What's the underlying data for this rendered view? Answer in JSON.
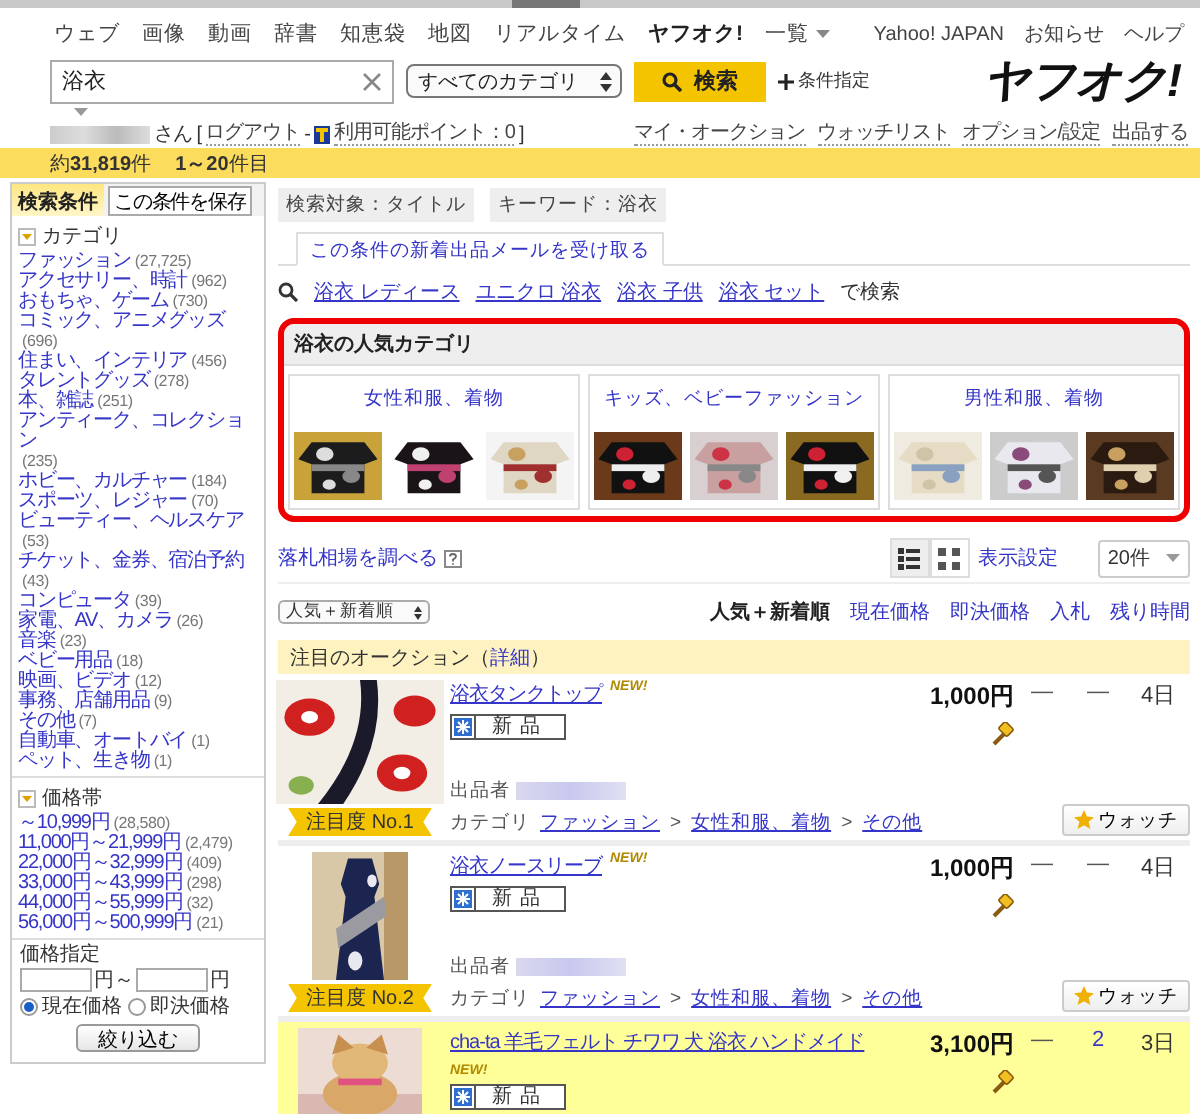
{
  "top_nav": {
    "links": [
      {
        "label": "ウェブ",
        "selected": false,
        "has_menu": false
      },
      {
        "label": "画像",
        "selected": false,
        "has_menu": false
      },
      {
        "label": "動画",
        "selected": false,
        "has_menu": false
      },
      {
        "label": "辞書",
        "selected": false,
        "has_menu": false
      },
      {
        "label": "知恵袋",
        "selected": false,
        "has_menu": false
      },
      {
        "label": "地図",
        "selected": false,
        "has_menu": false
      },
      {
        "label": "リアルタイム",
        "selected": false,
        "has_menu": false
      },
      {
        "label": "ヤフオク!",
        "selected": true,
        "has_menu": false
      },
      {
        "label": "一覧",
        "selected": false,
        "has_menu": true
      }
    ],
    "right_links": [
      "Yahoo! JAPAN",
      "お知らせ",
      "ヘルプ"
    ]
  },
  "search": {
    "value": "浴衣",
    "category": "すべてのカテゴリ",
    "button": "検索",
    "advanced": "条件指定"
  },
  "logo": "ヤフオク!",
  "user_bar": {
    "after_name": "さん [",
    "logout": "ログアウト",
    "dash": "-",
    "points": "利用可能ポイント：0",
    "close": "]",
    "links": [
      "マイ・オークション",
      "ウォッチリスト",
      "オプション/設定",
      "出品する"
    ]
  },
  "result_bar": {
    "count": "約**31,819**件",
    "range": "**1～20**件目"
  },
  "sidebar": {
    "title": "検索条件",
    "save_button": "この条件を保存",
    "category": {
      "title": "カテゴリ",
      "expanded": true,
      "items": [
        {
          "label": "ファッション",
          "count": "(27,725)"
        },
        {
          "label": "アクセサリー、時計",
          "count": "(962)"
        },
        {
          "label": "おもちゃ、ゲーム",
          "count": "(730)"
        },
        {
          "label": "コミック、アニメグッズ",
          "count": "(696)"
        },
        {
          "label": "住まい、インテリア",
          "count": "(456)"
        },
        {
          "label": "タレントグッズ",
          "count": "(278)"
        },
        {
          "label": "本、雑誌",
          "count": "(251)"
        },
        {
          "label": "アンティーク、コレクション",
          "count": "(235)"
        },
        {
          "label": "ホビー、カルチャー",
          "count": "(184)"
        },
        {
          "label": "スポーツ、レジャー",
          "count": "(70)"
        },
        {
          "label": "ビューティー、ヘルスケア",
          "count": "(53)"
        },
        {
          "label": "チケット、金券、宿泊予約",
          "count": "(43)"
        },
        {
          "label": "コンピュータ",
          "count": "(39)"
        },
        {
          "label": "家電、AV、カメラ",
          "count": "(26)"
        },
        {
          "label": "音楽",
          "count": "(23)"
        },
        {
          "label": "ベビー用品",
          "count": "(18)"
        },
        {
          "label": "映画、ビデオ",
          "count": "(12)"
        },
        {
          "label": "事務、店舗用品",
          "count": "(9)"
        },
        {
          "label": "その他",
          "count": "(7)"
        },
        {
          "label": "自動車、オートバイ",
          "count": "(1)"
        },
        {
          "label": "ペット、生き物",
          "count": "(1)"
        }
      ]
    },
    "price": {
      "title": "価格帯",
      "expanded": true,
      "items": [
        {
          "label": "～10,999円",
          "count": "(28,580)"
        },
        {
          "label": "11,000円～21,999円",
          "count": "(2,479)"
        },
        {
          "label": "22,000円～32,999円",
          "count": "(409)"
        },
        {
          "label": "33,000円～43,999円",
          "count": "(298)"
        },
        {
          "label": "44,000円～55,999円",
          "count": "(32)"
        },
        {
          "label": "56,000円～500,999円",
          "count": "(21)"
        }
      ]
    },
    "price_input": {
      "title": "価格指定",
      "between": "円～",
      "unit": "円",
      "options": [
        {
          "label": "現在価格",
          "selected": true
        },
        {
          "label": "即決価格",
          "selected": false
        }
      ],
      "button": "絞り込む"
    }
  },
  "filters": [
    "検索対象：タイトル",
    "キーワード：浴衣"
  ],
  "mail_tab": "この条件の新着出品メールを受け取る",
  "related": {
    "links": [
      "浴衣 レディース",
      "ユニクロ 浴衣",
      "浴衣 子供",
      "浴衣 セット"
    ],
    "suffix": "で検索"
  },
  "popular": {
    "title": "浴衣の人気カテゴリ",
    "cards": [
      {
        "label": "女性和服、着物"
      },
      {
        "label": "キッズ、ベビーファッション"
      },
      {
        "label": "男性和服、着物"
      }
    ]
  },
  "market_link": "落札相場を調べる",
  "view": {
    "modes": [
      {
        "kind": "list",
        "selected": true
      },
      {
        "kind": "grid",
        "selected": false
      }
    ],
    "settings": "表示設定",
    "per_page": "20件"
  },
  "sort": {
    "dropdown": "人気＋新着順",
    "columns": [
      {
        "label": "人気＋新着順",
        "selected": true
      },
      {
        "label": "現在価格",
        "selected": false
      },
      {
        "label": "即決価格",
        "selected": false
      },
      {
        "label": "入札",
        "selected": false
      },
      {
        "label": "残り時間",
        "selected": false
      }
    ]
  },
  "featured": {
    "before": "注目のオークション（",
    "link": "詳細",
    "after": "）"
  },
  "listings": [
    {
      "title": "浴衣タンクトップ",
      "new_label": "NEW!",
      "condition": "新品",
      "price": "1,000円",
      "buy_now": "—",
      "bids": "—",
      "bids_linked": false,
      "time_left": "4日",
      "rank": "注目度 No.1",
      "seller_label": "出品者",
      "category_label": "カテゴリ",
      "path": [
        "ファッション",
        "女性和服、着物",
        "その他"
      ],
      "separator": ">",
      "watch": "ウォッチ",
      "highlighted": false
    },
    {
      "title": "浴衣ノースリーブ",
      "new_label": "NEW!",
      "condition": "新品",
      "price": "1,000円",
      "buy_now": "—",
      "bids": "—",
      "bids_linked": false,
      "time_left": "4日",
      "rank": "注目度 No.2",
      "seller_label": "出品者",
      "category_label": "カテゴリ",
      "path": [
        "ファッション",
        "女性和服、着物",
        "その他"
      ],
      "separator": ">",
      "watch": "ウォッチ",
      "highlighted": false
    },
    {
      "title": "cha-ta 羊毛フェルト チワワ 犬 浴衣 ハンドメイド",
      "new_label": "NEW!",
      "condition": "新品",
      "price": "3,100円",
      "buy_now": "—",
      "bids": "2",
      "bids_linked": true,
      "time_left": "3日",
      "highlighted": true
    }
  ]
}
